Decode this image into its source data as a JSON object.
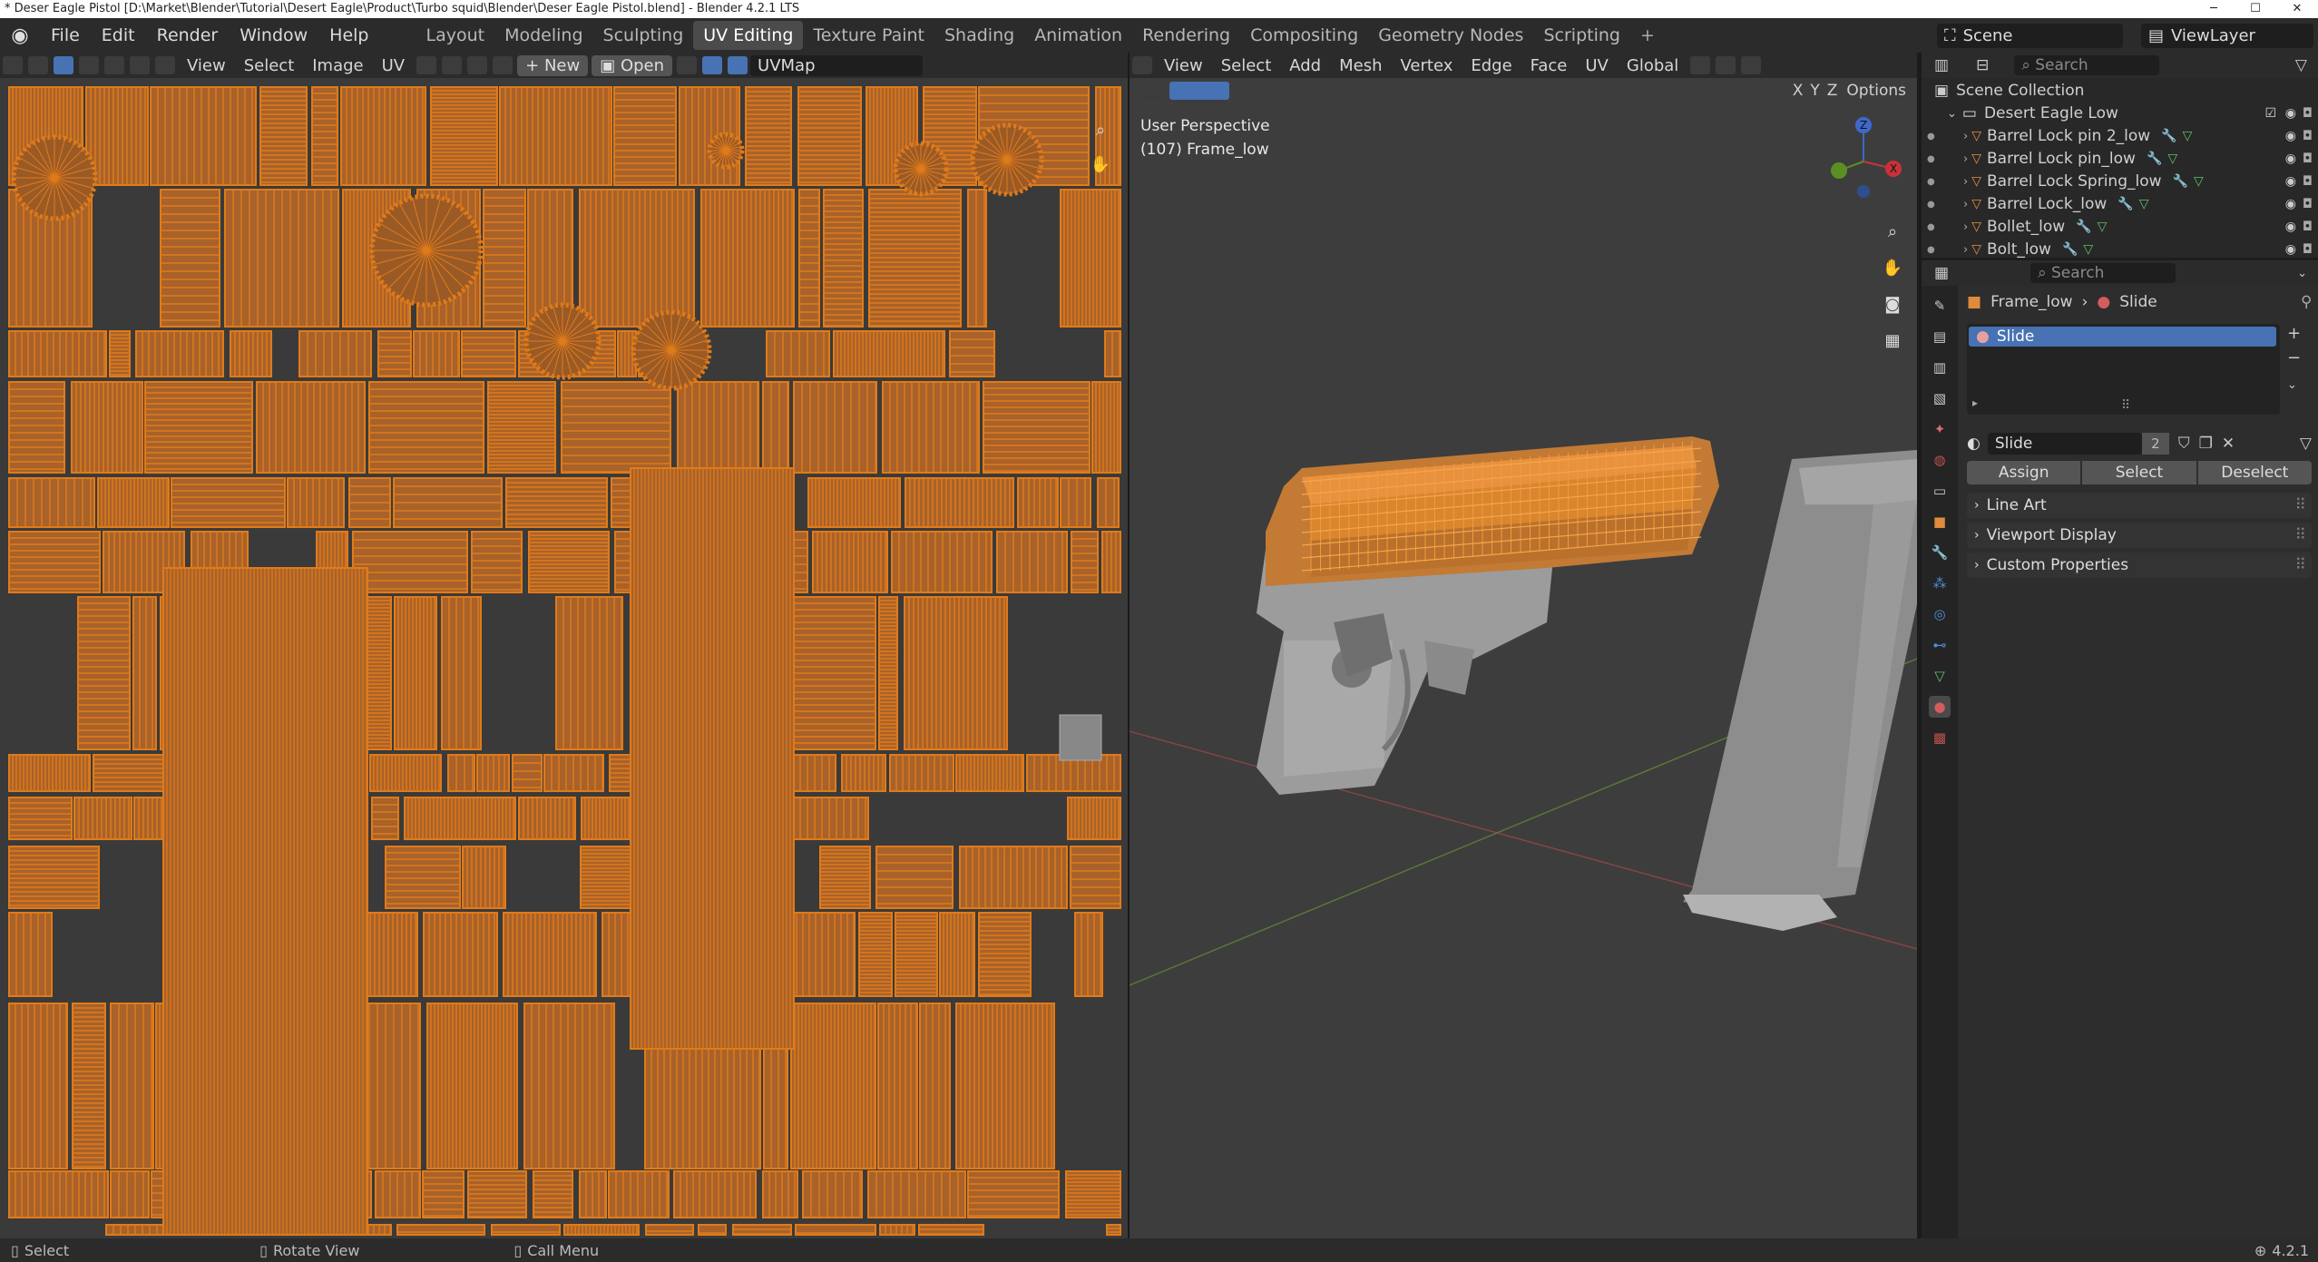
{
  "window": {
    "title": "* Deser Eagle Pistol [D:\\Market\\Blender\\Tutorial\\Desert Eagle\\Product\\Turbo squid\\Blender\\Deser Eagle Pistol.blend] - Blender 4.2.1 LTS",
    "min": "─",
    "max": "☐",
    "close": "✕"
  },
  "menu": [
    "File",
    "Edit",
    "Render",
    "Window",
    "Help"
  ],
  "workspaces": [
    "Layout",
    "Modeling",
    "Sculpting",
    "UV Editing",
    "Texture Paint",
    "Shading",
    "Animation",
    "Rendering",
    "Compositing",
    "Geometry Nodes",
    "Scripting",
    "+"
  ],
  "active_workspace": "UV Editing",
  "scene": "Scene",
  "view_layer": "ViewLayer",
  "uv_editor": {
    "menus": [
      "View",
      "Select",
      "Image",
      "UV"
    ],
    "new_label": "New",
    "open_label": "Open",
    "uvmap": "UVMap",
    "mesh_color": "#e07b1a",
    "bg_color": "#3a3a3a"
  },
  "viewport": {
    "menus": [
      "View",
      "Select",
      "Add",
      "Mesh",
      "Vertex",
      "Edge",
      "Face",
      "UV"
    ],
    "transform": "Global",
    "options": "Options",
    "axes": [
      "X",
      "Y",
      "Z"
    ],
    "perspective": "User Perspective",
    "object_info": "(107) Frame_low",
    "gizmo_axes": [
      "Z",
      "Y",
      "X"
    ]
  },
  "outliner": {
    "search_placeholder": "Search",
    "root": "Scene Collection",
    "collection": "Desert Eagle Low",
    "items": [
      "Barrel Lock pin 2_low",
      "Barrel Lock pin_low",
      "Barrel Lock Spring_low",
      "Barrel Lock_low",
      "Bollet_low",
      "Bolt_low"
    ]
  },
  "properties": {
    "search_placeholder": "Search",
    "breadcrumb_object": "Frame_low",
    "breadcrumb_material": "Slide",
    "slot": "Slide",
    "material_name": "Slide",
    "user_count": "2",
    "assign": "Assign",
    "select": "Select",
    "deselect": "Deselect",
    "panels": [
      "Line Art",
      "Viewport Display",
      "Custom Properties"
    ]
  },
  "status": {
    "select": "Select",
    "rotate": "Rotate View",
    "menu": "Call Menu",
    "version": "4.2.1"
  }
}
